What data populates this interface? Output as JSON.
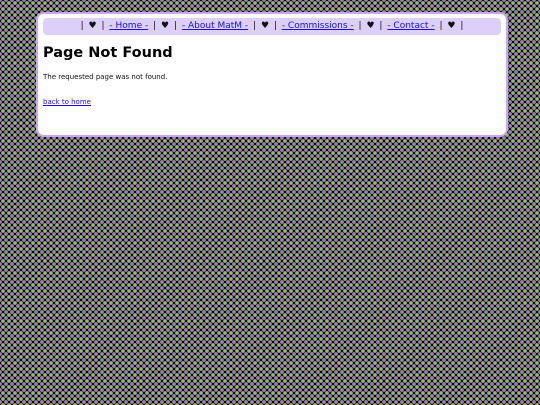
{
  "nav": {
    "separator": "|",
    "heart": "♥",
    "items": [
      {
        "label": "- Home -"
      },
      {
        "label": "- About MatM -"
      },
      {
        "label": "- Commissions -"
      },
      {
        "label": "- Contact -"
      }
    ]
  },
  "main": {
    "title": "Page Not Found",
    "message": "The requested page was not found.",
    "back_link": "back to home"
  }
}
